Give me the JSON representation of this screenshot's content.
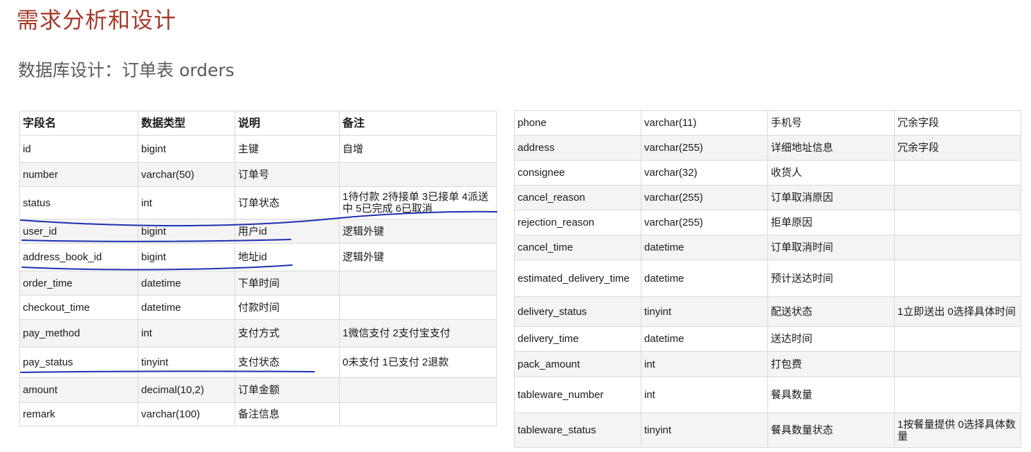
{
  "title": "需求分析和设计",
  "subtitle": "数据库设计：订单表 orders",
  "left_table": {
    "headers": [
      "字段名",
      "数据类型",
      "说明",
      "备注"
    ],
    "rows": [
      [
        "id",
        "bigint",
        "主键",
        "自增"
      ],
      [
        "number",
        "varchar(50)",
        "订单号",
        ""
      ],
      [
        "status",
        "int",
        "订单状态",
        "1待付款 2待接单 3已接单 4派送中 5已完成 6已取消"
      ],
      [
        "user_id",
        "bigint",
        "用户id",
        "逻辑外键"
      ],
      [
        "address_book_id",
        "bigint",
        "地址id",
        "逻辑外键"
      ],
      [
        "order_time",
        "datetime",
        "下单时间",
        ""
      ],
      [
        "checkout_time",
        "datetime",
        "付款时间",
        ""
      ],
      [
        "pay_method",
        "int",
        "支付方式",
        "1微信支付 2支付宝支付"
      ],
      [
        "pay_status",
        "tinyint",
        "支付状态",
        "0未支付 1已支付 2退款"
      ],
      [
        "amount",
        "decimal(10,2)",
        "订单金额",
        ""
      ],
      [
        "remark",
        "varchar(100)",
        "备注信息",
        ""
      ]
    ]
  },
  "right_table": {
    "rows": [
      [
        "phone",
        "varchar(11)",
        "手机号",
        "冗余字段"
      ],
      [
        "address",
        "varchar(255)",
        "详细地址信息",
        "冗余字段"
      ],
      [
        "consignee",
        "varchar(32)",
        "收货人",
        ""
      ],
      [
        "cancel_reason",
        "varchar(255)",
        "订单取消原因",
        ""
      ],
      [
        "rejection_reason",
        "varchar(255)",
        "拒单原因",
        ""
      ],
      [
        "cancel_time",
        "datetime",
        "订单取消时间",
        ""
      ],
      [
        "estimated_delivery_time",
        "datetime",
        "预计送达时间",
        ""
      ],
      [
        "delivery_status",
        "tinyint",
        "配送状态",
        "1立即送出 0选择具体时间"
      ],
      [
        "delivery_time",
        "datetime",
        "送达时间",
        ""
      ],
      [
        "pack_amount",
        "int",
        "打包费",
        ""
      ],
      [
        "tableware_number",
        "int",
        "餐具数量",
        ""
      ],
      [
        "tableware_status",
        "tinyint",
        "餐具数量状态",
        "1按餐量提供 0选择具体数量"
      ]
    ]
  },
  "colors": {
    "title": "#a33a2a",
    "subtitle": "#5a5a5a",
    "annotation_ink": "#1a2fb0"
  }
}
